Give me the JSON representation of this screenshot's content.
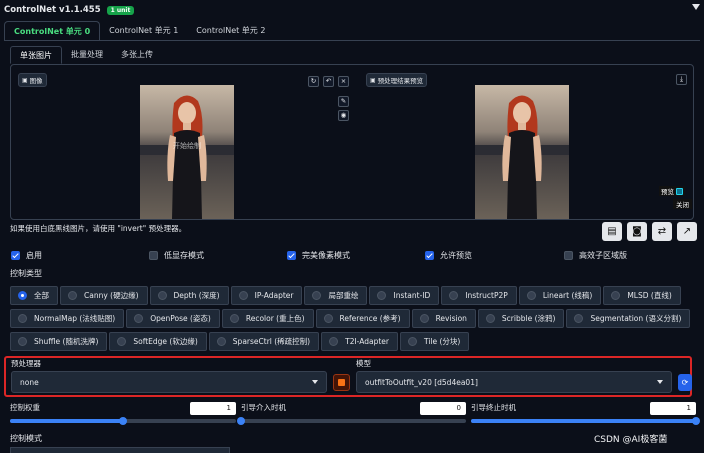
{
  "header": {
    "title": "ControlNet v1.1.455",
    "badge": "1 unit"
  },
  "unit_tabs": [
    "ControlNet 单元 0",
    "ControlNet 单元 1",
    "ControlNet 单元 2"
  ],
  "image_tabs": [
    "单张图片",
    "批量处理",
    "多张上传"
  ],
  "image_panel": {
    "left_label": "图像",
    "right_label": "预处理结果预览",
    "overlay_text": "开始绘制",
    "preview_checkbox": "预览",
    "close_label": "关闭"
  },
  "tool_icons": [
    "rotate-icon",
    "undo-icon",
    "close-icon",
    "pen-icon",
    "eye-icon",
    "download-icon"
  ],
  "hint": "如果使用白底黑线图片，请使用 \"invert\" 预处理器。",
  "action_icons": [
    "document-icon",
    "camera-icon",
    "swap-icon",
    "send-icon"
  ],
  "options": [
    {
      "label": "启用",
      "checked": true
    },
    {
      "label": "低显存模式",
      "checked": false
    },
    {
      "label": "完美像素模式",
      "checked": true
    },
    {
      "label": "允许预览",
      "checked": true
    },
    {
      "label": "高效子区域版",
      "checked": false
    }
  ],
  "control_type": {
    "label": "控制类型",
    "selected": "全部",
    "rows": [
      [
        "全部",
        "Canny (硬边缘)",
        "Depth (深度)",
        "IP-Adapter",
        "局部重绘",
        "Instant-ID",
        "InstructP2P",
        "Lineart (线稿)",
        "MLSD (直线)"
      ],
      [
        "NormalMap (法线贴图)",
        "OpenPose (姿态)",
        "Recolor (重上色)",
        "Reference (参考)",
        "Revision",
        "Scribble (涂鸦)",
        "Segmentation (语义分割)"
      ],
      [
        "Shuffle (随机洗牌)",
        "SoftEdge (软边缘)",
        "SparseCtrl (稀疏控制)",
        "T2I-Adapter",
        "Tile (分块)"
      ]
    ]
  },
  "preprocessor": {
    "label": "预处理器",
    "value": "none"
  },
  "model": {
    "label": "模型",
    "value": "outfitToOutfit_v20 [d5d4ea01]"
  },
  "sliders": [
    {
      "label": "控制权重",
      "value": "1",
      "fraction": 0.5
    },
    {
      "label": "引导介入时机",
      "value": "0",
      "fraction": 0.0
    },
    {
      "label": "引导终止时机",
      "value": "1",
      "fraction": 1.0
    }
  ],
  "control_mode": {
    "label": "控制模式"
  },
  "watermark": "CSDN @AI极客菌",
  "colors": {
    "accent": "#2563eb",
    "active_tab": "#4ade80",
    "badge": "#16a34a",
    "highlight_box": "#dc2626",
    "background": "#0b0f19"
  }
}
